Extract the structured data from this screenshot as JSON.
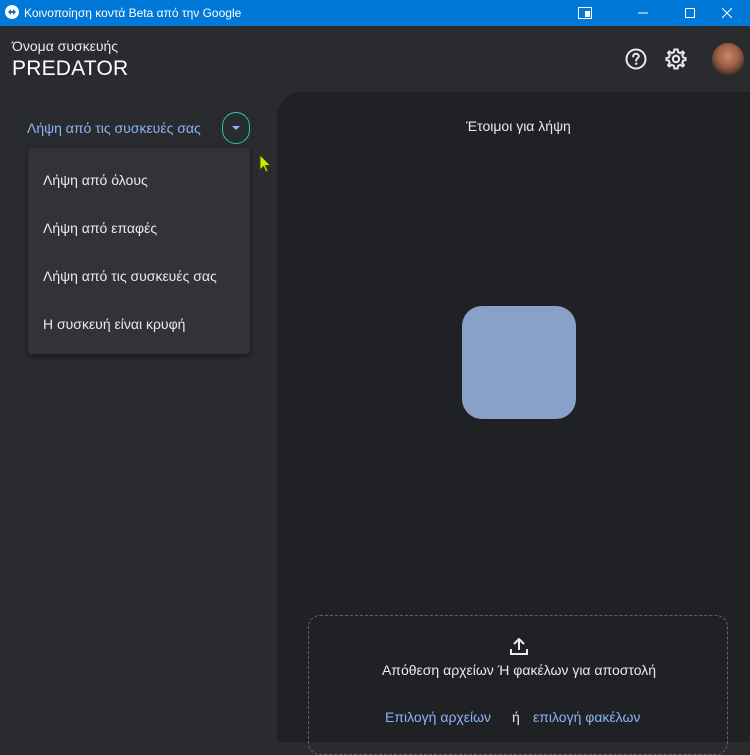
{
  "window": {
    "title": "Κοινοποίηση κοντά Beta από την Google"
  },
  "header": {
    "device_label": "Όνομα συσκευής",
    "device_name": "PREDATOR"
  },
  "visibility": {
    "current": "Λήψη από τις συσκευές σας",
    "options": [
      "Λήψη από όλους",
      "Λήψη από επαφές",
      "Λήψη από τις συσκευές σας",
      "Η συσκευή είναι κρυφή"
    ]
  },
  "main": {
    "status": "Έτοιμοι για λήψη",
    "drop_text": "Απόθεση αρχείων Ή φακέλων για αποστολή",
    "select_files": "Επιλογή αρχείων",
    "or": "ή",
    "select_folders": "επιλογή φακέλων"
  },
  "colors": {
    "titlebar": "#0078d7",
    "accent_link": "#8ab4f8",
    "toggle_outline": "#26c6b0",
    "device_tile": "#89a0c8"
  }
}
